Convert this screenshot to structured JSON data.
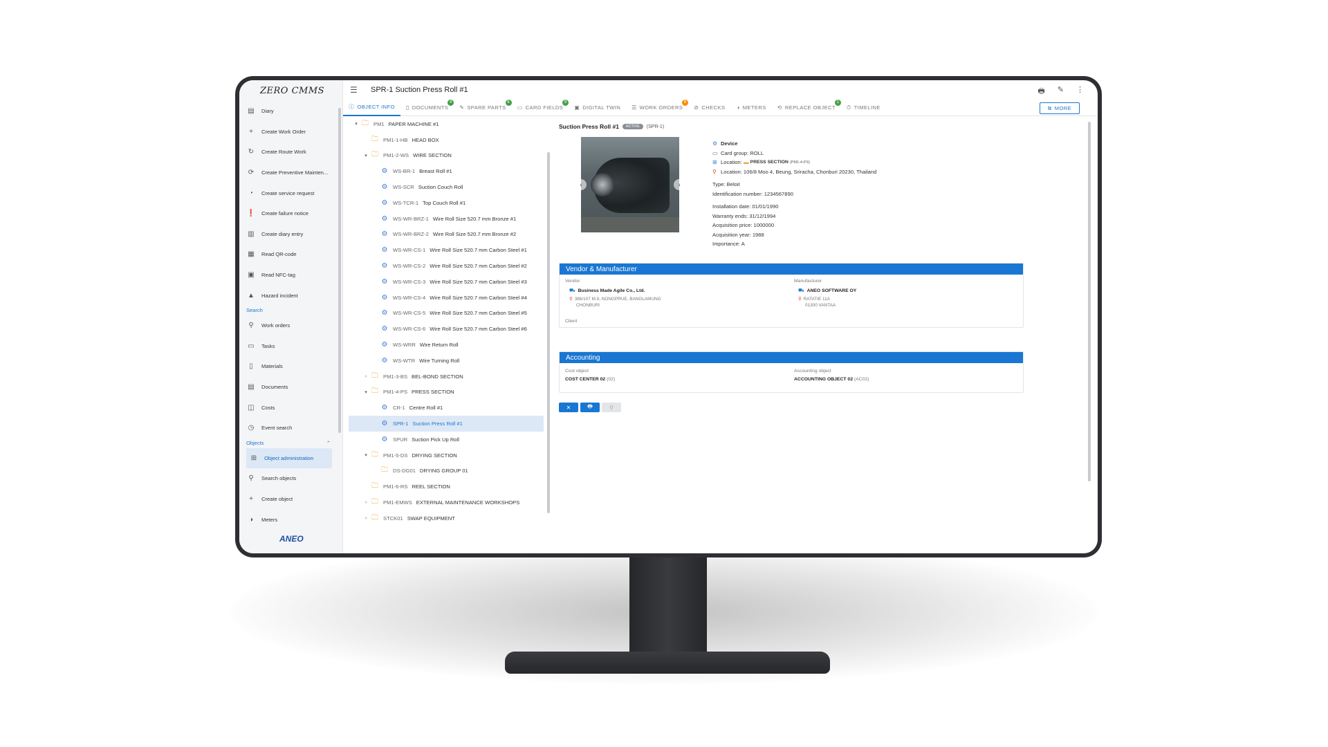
{
  "app": {
    "logo": "ZERO CMMS",
    "page_title": "SPR-1 Suction Press Roll #1",
    "footer_logo": "ANEO"
  },
  "header": {
    "icons": [
      "print-icon",
      "edit-icon",
      "more-vert-icon"
    ]
  },
  "sidebar": {
    "actions": [
      {
        "label": "Diary",
        "icon": "diary-icon"
      },
      {
        "label": "Create Work Order",
        "icon": "plus-icon"
      },
      {
        "label": "Create Route Work",
        "icon": "route-icon"
      },
      {
        "label": "Create Preventive Mainten...",
        "icon": "refresh-icon"
      },
      {
        "label": "Create service request",
        "icon": "service-icon"
      },
      {
        "label": "Create failure notice",
        "icon": "warning-circle-icon"
      },
      {
        "label": "Create diary entry",
        "icon": "diary-entry-icon"
      },
      {
        "label": "Read QR-code",
        "icon": "qr-icon"
      },
      {
        "label": "Read NFC-tag",
        "icon": "nfc-icon"
      },
      {
        "label": "Hazard incident",
        "icon": "hazard-icon"
      }
    ],
    "search_header": "Search",
    "search_items": [
      {
        "label": "Work orders",
        "icon": "search-icon"
      },
      {
        "label": "Tasks",
        "icon": "calendar-icon"
      },
      {
        "label": "Materials",
        "icon": "clipboard-icon"
      },
      {
        "label": "Documents",
        "icon": "document-icon"
      },
      {
        "label": "Costs",
        "icon": "costs-icon"
      },
      {
        "label": "Event search",
        "icon": "history-icon"
      }
    ],
    "objects_header": "Objects",
    "object_items": [
      {
        "label": "Object administration",
        "icon": "hierarchy-icon"
      },
      {
        "label": "Search objects",
        "icon": "search-icon"
      },
      {
        "label": "Create object",
        "icon": "plus-icon"
      },
      {
        "label": "Meters",
        "icon": "gauge-icon"
      }
    ]
  },
  "tabs": [
    {
      "label": "OBJECT INFO",
      "badge": "",
      "badge_color": ""
    },
    {
      "label": "DOCUMENTS",
      "badge": "4",
      "badge_color": "#43a047"
    },
    {
      "label": "SPARE PARTS",
      "badge": "6",
      "badge_color": "#43a047"
    },
    {
      "label": "CARD FIELDS",
      "badge": "9",
      "badge_color": "#43a047"
    },
    {
      "label": "DIGITAL TWIN",
      "badge": "",
      "badge_color": ""
    },
    {
      "label": "WORK ORDERS",
      "badge": "6",
      "badge_color": "#fb8c00"
    },
    {
      "label": "CHECKS",
      "badge": "",
      "badge_color": ""
    },
    {
      "label": "METERS",
      "badge": "",
      "badge_color": ""
    },
    {
      "label": "REPLACE OBJECT",
      "badge": "1",
      "badge_color": "#43a047"
    },
    {
      "label": "TIMELINE",
      "badge": "",
      "badge_color": ""
    }
  ],
  "more_label": "MORE",
  "tree": [
    {
      "code": "PM1",
      "name": "PAPER MACHINE #1",
      "type": "folder",
      "level": 0,
      "caret": "down"
    },
    {
      "code": "PM1-1-HB",
      "name": "HEAD BOX",
      "type": "folder",
      "level": 1,
      "caret": ""
    },
    {
      "code": "PM1-2-WS",
      "name": "WIRE SECTION",
      "type": "folder",
      "level": 1,
      "caret": "down"
    },
    {
      "code": "WS-BR-1",
      "name": "Breast Roll #1",
      "type": "device",
      "level": 2,
      "caret": ""
    },
    {
      "code": "WS-SCR",
      "name": "Suction Couch Roll",
      "type": "device",
      "level": 2,
      "caret": ""
    },
    {
      "code": "WS-TCR-1",
      "name": "Top Couch Roll #1",
      "type": "device",
      "level": 2,
      "caret": ""
    },
    {
      "code": "WS-WR-BRZ-1",
      "name": "Wire Roll Size 520.7 mm Bronze #1",
      "type": "device",
      "level": 2,
      "caret": ""
    },
    {
      "code": "WS-WR-BRZ-2",
      "name": "Wire Roll Size 520.7 mm Bronze #2",
      "type": "device",
      "level": 2,
      "caret": ""
    },
    {
      "code": "WS-WR-CS-1",
      "name": "Wire Roll Size 520.7 mm Carbon Steel #1",
      "type": "device",
      "level": 2,
      "caret": ""
    },
    {
      "code": "WS-WR-CS-2",
      "name": "Wire Roll Size 520.7 mm Carbon Steel #2",
      "type": "device",
      "level": 2,
      "caret": ""
    },
    {
      "code": "WS-WR-CS-3",
      "name": "Wire Roll Size 520.7 mm Carbon Steel #3",
      "type": "device",
      "level": 2,
      "caret": ""
    },
    {
      "code": "WS-WR-CS-4",
      "name": "Wire Roll Size 520.7 mm Carbon Steel #4",
      "type": "device",
      "level": 2,
      "caret": ""
    },
    {
      "code": "WS-WR-CS-5",
      "name": "Wire Roll Size 520.7 mm Carbon Steel #5",
      "type": "device",
      "level": 2,
      "caret": ""
    },
    {
      "code": "WS-WR-CS-6",
      "name": "Wire Roll Size 520.7 mm Carbon Steel #6",
      "type": "device",
      "level": 2,
      "caret": ""
    },
    {
      "code": "WS-WRR",
      "name": "Wire Return Roll",
      "type": "device",
      "level": 2,
      "caret": ""
    },
    {
      "code": "WS-WTR",
      "name": "Wire Turning Roll",
      "type": "device",
      "level": 2,
      "caret": ""
    },
    {
      "code": "PM1-3-BS",
      "name": "BEL-BOND SECTION",
      "type": "folder",
      "level": 1,
      "caret": "right"
    },
    {
      "code": "PM1-4-PS",
      "name": "PRESS SECTION",
      "type": "folder",
      "level": 1,
      "caret": "down"
    },
    {
      "code": "CR-1",
      "name": "Centre Roll #1",
      "type": "device",
      "level": 2,
      "caret": ""
    },
    {
      "code": "SPR-1",
      "name": "Suction Press Roll #1",
      "type": "device",
      "level": 2,
      "caret": "",
      "selected": true
    },
    {
      "code": "SPUR",
      "name": "Suction Pick Up Roll",
      "type": "device",
      "level": 2,
      "caret": ""
    },
    {
      "code": "PM1-5-DS",
      "name": "DRYING SECTION",
      "type": "folder",
      "level": 1,
      "caret": "down"
    },
    {
      "code": "DS-DG01",
      "name": "DRYING GROUP 01",
      "type": "folder",
      "level": 2,
      "caret": ""
    },
    {
      "code": "PM1-6-RS",
      "name": "REEL SECTION",
      "type": "folder",
      "level": 1,
      "caret": ""
    },
    {
      "code": "PM1-EMWS",
      "name": "EXTERNAL MAINTENANCE WORKSHOPS",
      "type": "folder",
      "level": 1,
      "caret": "right"
    },
    {
      "code": "STCK01",
      "name": "SWAP EQUIPMENT",
      "type": "folder",
      "level": 1,
      "caret": "right"
    }
  ],
  "detail": {
    "title": "Suction Press Roll #1",
    "status": "ACTIVE",
    "code": "(SPR-1)",
    "info": {
      "kind": "Device",
      "card_group": "Card group: ROLL",
      "location_prefix": "Location:",
      "location_name": "PRESS SECTION",
      "location_code": "(PM1-4-PS)",
      "address": "Location: 106/8 Moo 4, Beung, Sriracha, Chonburi 20230, Thailand",
      "type": "Type: Beloit",
      "identification": "Identification number: 1234567890",
      "installation": "Installation date: 01/01/1990",
      "warranty": "Warranty ends: 31/12/1994",
      "acq_price": "Acquisition price: 1000000",
      "acq_year": "Acquisition year: 1988",
      "importance": "Importance: A"
    },
    "vendor_panel": {
      "title": "Vendor & Manufacturer",
      "vendor_label": "Vendor",
      "vendor_name": "Business Made Agile Co., Ltd.",
      "vendor_addr1": "386/107 M.9, NONGPRUE, BANGLAMUNG",
      "vendor_addr2": "CHONBURI",
      "manufacturer_label": "Manufacturer",
      "manufacturer_name": "ANEO SOFTWARE OY",
      "manufacturer_addr1": "RATATIE 11A",
      "manufacturer_addr2": "01300 VANTAA",
      "client_label": "Client"
    },
    "accounting_panel": {
      "title": "Accounting",
      "cost_label": "Cost object",
      "cost_value": "COST CENTER 02",
      "cost_code": "(02)",
      "acc_label": "Accounting object",
      "acc_value": "ACCOUNTING OBJECT 02",
      "acc_code": "(AC02)"
    },
    "buttons": [
      "close-icon",
      "print-icon",
      "pin-icon"
    ]
  }
}
